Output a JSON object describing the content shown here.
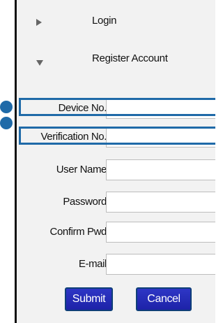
{
  "menu": {
    "login_label": "Login",
    "register_label": "Register Account"
  },
  "form": {
    "fields": [
      {
        "label": "Device No.",
        "value": ""
      },
      {
        "label": "Verification No.",
        "value": ""
      },
      {
        "label": "User Name",
        "value": ""
      },
      {
        "label": "Password",
        "value": ""
      },
      {
        "label": "Confirm Pwd",
        "value": ""
      },
      {
        "label": "E-mail",
        "value": ""
      }
    ]
  },
  "buttons": {
    "submit_label": "Submit",
    "cancel_label": "Cancel"
  },
  "colors": {
    "highlight": "#1f6aa8",
    "button_fill": "#2e36c6",
    "button_border": "#0f3f78"
  },
  "icons": {
    "collapsed": "triangle-right-icon",
    "expanded": "triangle-down-icon"
  }
}
